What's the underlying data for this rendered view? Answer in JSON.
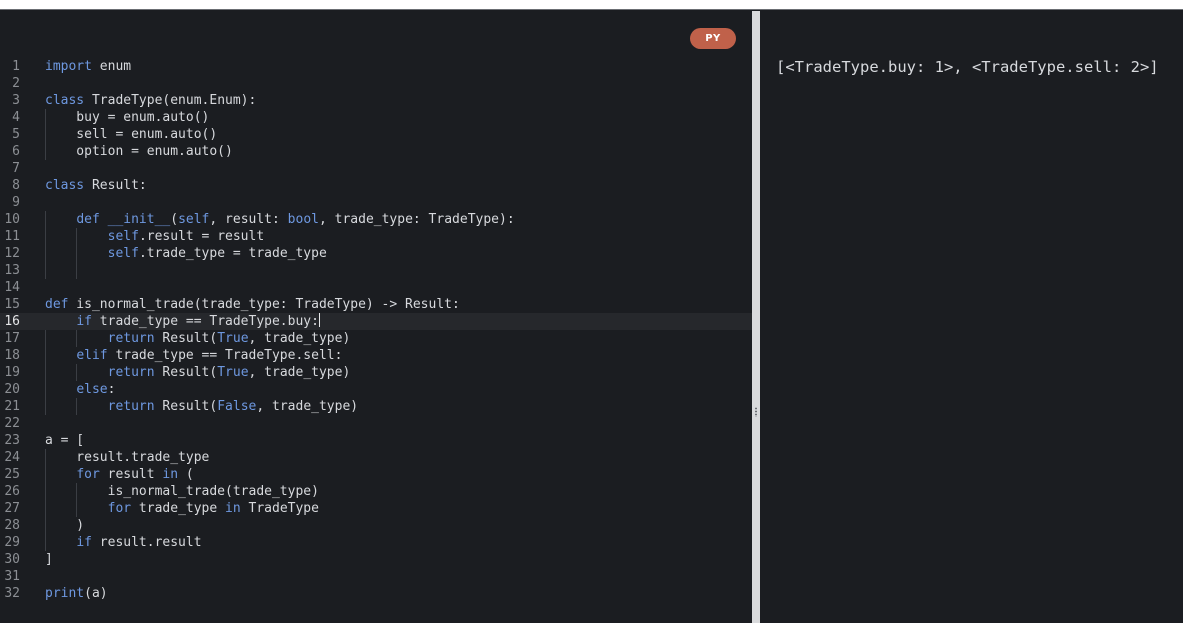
{
  "editor": {
    "language_badge": "PY",
    "active_line": 16,
    "lines": [
      {
        "n": "1",
        "t": [
          [
            "import",
            "kw"
          ],
          [
            " enum",
            ""
          ]
        ]
      },
      {
        "n": "2",
        "t": []
      },
      {
        "n": "3",
        "t": [
          [
            "class",
            "kw"
          ],
          [
            " TradeType(enum.Enum):",
            ""
          ]
        ]
      },
      {
        "n": "4",
        "t": [
          [
            "    buy = enum.auto()",
            ""
          ]
        ]
      },
      {
        "n": "5",
        "t": [
          [
            "    sell = enum.auto()",
            ""
          ]
        ]
      },
      {
        "n": "6",
        "t": [
          [
            "    option = enum.auto()",
            ""
          ]
        ]
      },
      {
        "n": "7",
        "t": []
      },
      {
        "n": "8",
        "t": [
          [
            "class",
            "kw"
          ],
          [
            " Result:",
            ""
          ]
        ]
      },
      {
        "n": "9",
        "t": []
      },
      {
        "n": "10",
        "t": [
          [
            "    ",
            ""
          ],
          [
            "def",
            "kw"
          ],
          [
            " ",
            ""
          ],
          [
            "__init__",
            "kw"
          ],
          [
            "(",
            ""
          ],
          [
            "self",
            "kw"
          ],
          [
            ", result: ",
            ""
          ],
          [
            "bool",
            "kw"
          ],
          [
            ", trade_type: TradeType):",
            ""
          ]
        ]
      },
      {
        "n": "11",
        "t": [
          [
            "        ",
            ""
          ],
          [
            "self",
            "kw"
          ],
          [
            ".result = result",
            ""
          ]
        ]
      },
      {
        "n": "12",
        "t": [
          [
            "        ",
            ""
          ],
          [
            "self",
            "kw"
          ],
          [
            ".trade_type = trade_type",
            ""
          ]
        ]
      },
      {
        "n": "13",
        "t": []
      },
      {
        "n": "14",
        "t": []
      },
      {
        "n": "15",
        "t": [
          [
            "def",
            "kw"
          ],
          [
            " is_normal_trade(trade_type: TradeType) -> Result:",
            ""
          ]
        ]
      },
      {
        "n": "16",
        "t": [
          [
            "    ",
            ""
          ],
          [
            "if",
            "kw"
          ],
          [
            " trade_type == TradeType.buy:",
            ""
          ]
        ]
      },
      {
        "n": "17",
        "t": [
          [
            "        ",
            ""
          ],
          [
            "return",
            "kw"
          ],
          [
            " Result(",
            ""
          ],
          [
            "True",
            "kw"
          ],
          [
            ", trade_type)",
            ""
          ]
        ]
      },
      {
        "n": "18",
        "t": [
          [
            "    ",
            ""
          ],
          [
            "elif",
            "kw"
          ],
          [
            " trade_type == TradeType.sell:",
            ""
          ]
        ]
      },
      {
        "n": "19",
        "t": [
          [
            "        ",
            ""
          ],
          [
            "return",
            "kw"
          ],
          [
            " Result(",
            ""
          ],
          [
            "True",
            "kw"
          ],
          [
            ", trade_type)",
            ""
          ]
        ]
      },
      {
        "n": "20",
        "t": [
          [
            "    ",
            ""
          ],
          [
            "else",
            "kw"
          ],
          [
            ":",
            ""
          ]
        ]
      },
      {
        "n": "21",
        "t": [
          [
            "        ",
            ""
          ],
          [
            "return",
            "kw"
          ],
          [
            " Result(",
            ""
          ],
          [
            "False",
            "kw"
          ],
          [
            ", trade_type)",
            ""
          ]
        ]
      },
      {
        "n": "22",
        "t": []
      },
      {
        "n": "23",
        "t": [
          [
            "a = [",
            ""
          ]
        ]
      },
      {
        "n": "24",
        "t": [
          [
            "    result.trade_type",
            ""
          ]
        ]
      },
      {
        "n": "25",
        "t": [
          [
            "    ",
            ""
          ],
          [
            "for",
            "kw"
          ],
          [
            " result ",
            ""
          ],
          [
            "in",
            "kw"
          ],
          [
            " (",
            ""
          ]
        ]
      },
      {
        "n": "26",
        "t": [
          [
            "        is_normal_trade(trade_type)",
            ""
          ]
        ]
      },
      {
        "n": "27",
        "t": [
          [
            "        ",
            ""
          ],
          [
            "for",
            "kw"
          ],
          [
            " trade_type ",
            ""
          ],
          [
            "in",
            "kw"
          ],
          [
            " TradeType",
            ""
          ]
        ]
      },
      {
        "n": "28",
        "t": [
          [
            "    )",
            ""
          ]
        ]
      },
      {
        "n": "29",
        "t": [
          [
            "    ",
            ""
          ],
          [
            "if",
            "kw"
          ],
          [
            " result.result",
            ""
          ]
        ]
      },
      {
        "n": "30",
        "t": [
          [
            "]",
            ""
          ]
        ]
      },
      {
        "n": "31",
        "t": []
      },
      {
        "n": "32",
        "t": [
          [
            "print",
            "kw"
          ],
          [
            "(a)",
            ""
          ]
        ]
      }
    ]
  },
  "output": {
    "text": "[<TradeType.buy: 1>, <TradeType.sell: 2>]"
  }
}
